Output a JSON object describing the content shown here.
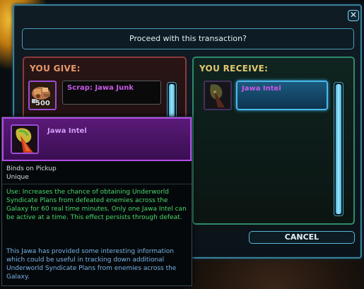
{
  "dialog": {
    "prompt": "Proceed with this transaction?",
    "close_label": "✕",
    "cancel_label": "CANCEL"
  },
  "give": {
    "title": "YOU GIVE:",
    "item_name": "Scrap: Jawa Junk",
    "quantity": "500"
  },
  "receive": {
    "title": "YOU RECEIVE:",
    "item_name": "Jawa Intel"
  },
  "tooltip": {
    "title": "Jawa Intel",
    "binds": "Binds on Pickup",
    "unique": "Unique",
    "use": "Use: Increases the chance of obtaining Underworld Syndicate Plans from defeated enemies across the Galaxy for 60 real time minutes. Only one Jawa Intel can be active at a time. This effect persists through defeat.",
    "flavor": "This Jawa has provided some interesting information which could be useful in tracking down additional Underworld Syndicate Plans from enemies across the Galaxy."
  },
  "colors": {
    "give_border": "#8a3a3a",
    "receive_border": "#2e8a6a",
    "accent": "#4ab8ec",
    "rarity_purple": "#b04ce8",
    "use_text": "#4ad86a"
  }
}
